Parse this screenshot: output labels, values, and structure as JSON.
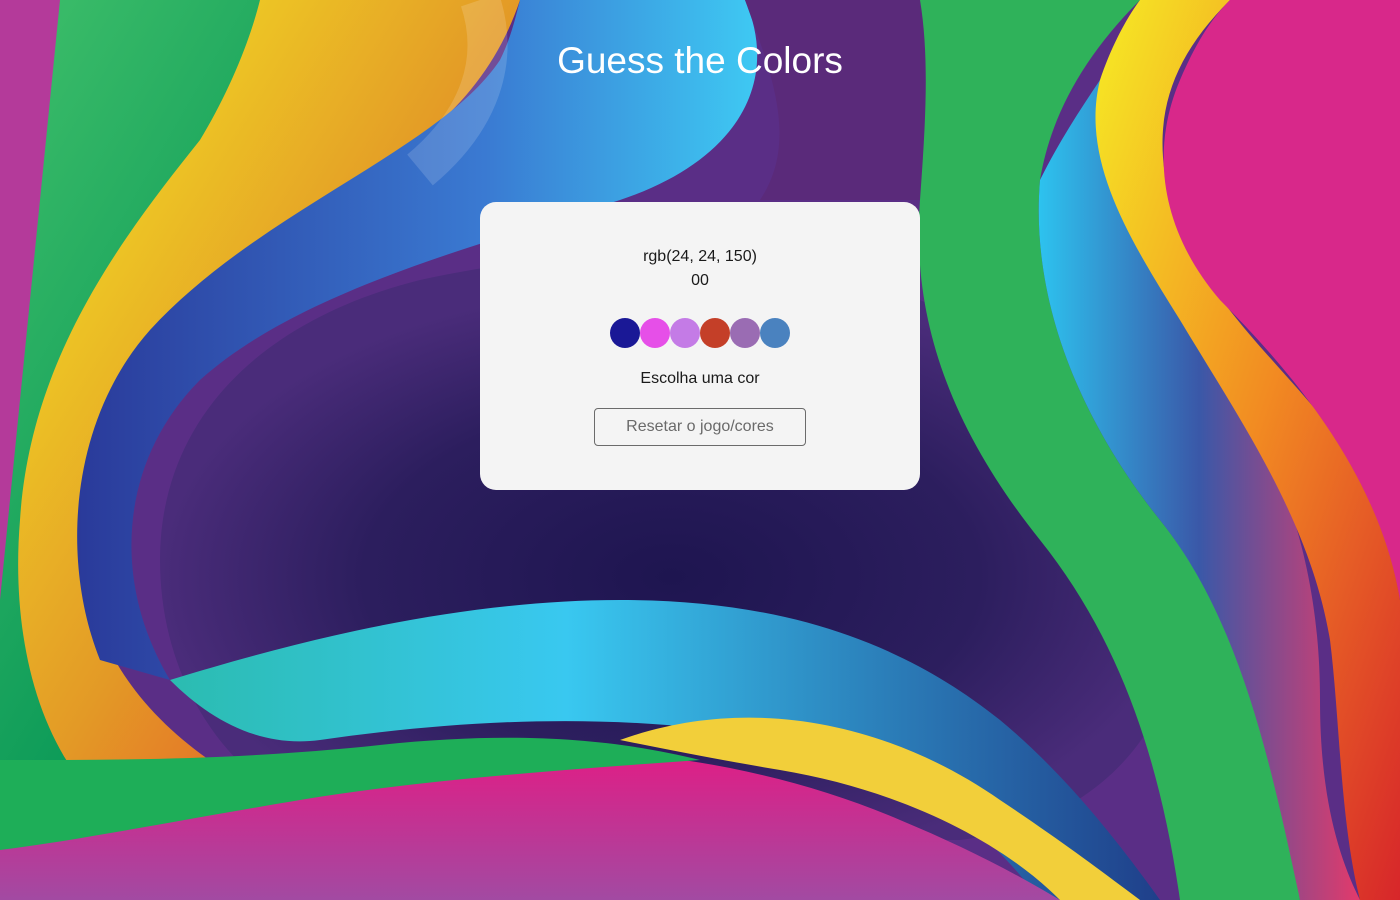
{
  "header": {
    "title": "Guess the Colors"
  },
  "game": {
    "rgb_color": "rgb(24, 24, 150)",
    "score": "00",
    "answer": "Escolha uma cor",
    "reset_label": "Resetar o jogo/cores",
    "balls": [
      {
        "color": "#1a1896",
        "icon": "color-ball"
      },
      {
        "color": "#e64fe8",
        "icon": "color-ball"
      },
      {
        "color": "#c47be6",
        "icon": "color-ball"
      },
      {
        "color": "#c43f28",
        "icon": "color-ball"
      },
      {
        "color": "#9a6cb3",
        "icon": "color-ball"
      },
      {
        "color": "#4a82bf",
        "icon": "color-ball"
      }
    ]
  },
  "theme": {
    "card_background": "#f4f4f4",
    "title_color": "#ffffff"
  }
}
